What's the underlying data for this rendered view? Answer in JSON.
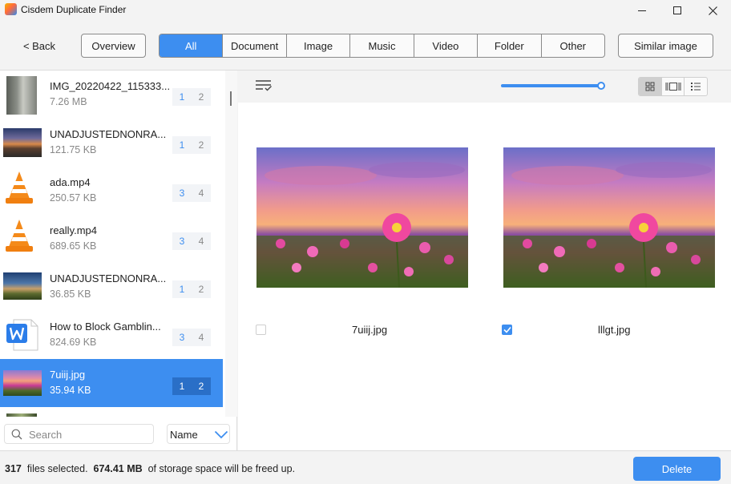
{
  "window": {
    "title": "Cisdem Duplicate Finder"
  },
  "toolbar": {
    "back_label": "< Back",
    "overview_label": "Overview",
    "similar_label": "Similar image",
    "tabs": [
      {
        "label": "All",
        "active": true
      },
      {
        "label": "Document"
      },
      {
        "label": "Image"
      },
      {
        "label": "Music"
      },
      {
        "label": "Video"
      },
      {
        "label": "Folder"
      },
      {
        "label": "Other"
      }
    ]
  },
  "files": [
    {
      "name": "IMG_20220422_115333...",
      "size": "7.26 MB",
      "count_a": "1",
      "count_b": "2",
      "thumb": "photo-icon"
    },
    {
      "name": "UNADJUSTEDNONRA...",
      "size": "121.75 KB",
      "count_a": "1",
      "count_b": "2",
      "thumb": "photo-icon"
    },
    {
      "name": "ada.mp4",
      "size": "250.57 KB",
      "count_a": "3",
      "count_b": "4",
      "thumb": "vlc-icon"
    },
    {
      "name": "really.mp4",
      "size": "689.65 KB",
      "count_a": "3",
      "count_b": "4",
      "thumb": "vlc-icon"
    },
    {
      "name": "UNADJUSTEDNONRA...",
      "size": "36.85 KB",
      "count_a": "1",
      "count_b": "2",
      "thumb": "photo-icon"
    },
    {
      "name": "How to Block Gamblin...",
      "size": "824.69 KB",
      "count_a": "3",
      "count_b": "4",
      "thumb": "word-doc-icon"
    },
    {
      "name": "7uiij.jpg",
      "size": "35.94 KB",
      "count_a": "1",
      "count_b": "2",
      "thumb": "photo-icon",
      "selected": true
    }
  ],
  "search": {
    "placeholder": "Search",
    "value": ""
  },
  "sort": {
    "selected": "Name"
  },
  "zoom": {
    "level": 1.0
  },
  "preview": [
    {
      "name": "7uiij.jpg",
      "checked": false
    },
    {
      "name": "lllgt.jpg",
      "checked": true
    }
  ],
  "status": {
    "files_selected": "317",
    "files_label": "files selected.",
    "space": "674.41 MB",
    "space_label": "of storage space will be freed up."
  },
  "delete_label": "Delete",
  "colors": {
    "accent": "#3d8ef0"
  }
}
